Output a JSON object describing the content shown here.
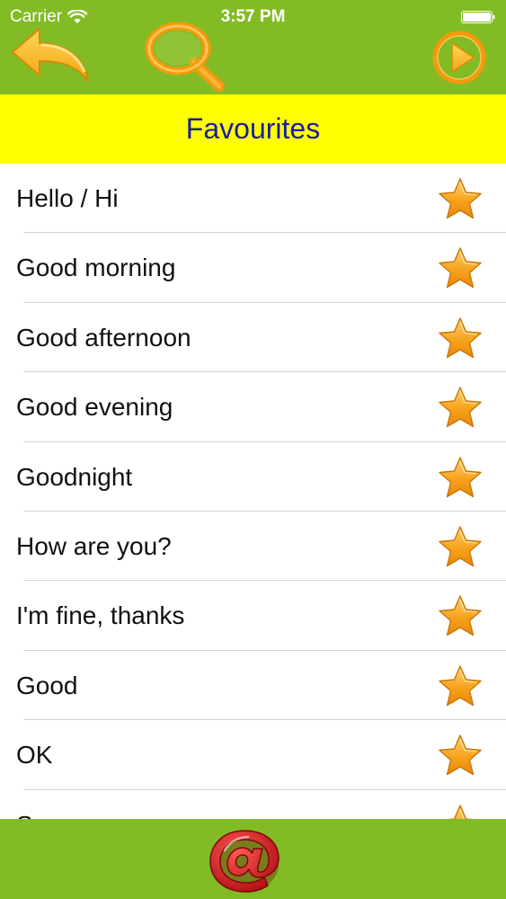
{
  "status_bar": {
    "carrier": "Carrier",
    "time": "3:57 PM"
  },
  "nav": {
    "back_icon": "back-arrow-icon",
    "search_icon": "magnifier-icon",
    "play_icon": "play-icon"
  },
  "header": {
    "title": "Favourites"
  },
  "list": {
    "items": [
      {
        "label": "Hello / Hi"
      },
      {
        "label": "Good morning"
      },
      {
        "label": "Good afternoon"
      },
      {
        "label": "Good evening"
      },
      {
        "label": "Goodnight"
      },
      {
        "label": "How are you?"
      },
      {
        "label": "I'm fine, thanks"
      },
      {
        "label": "Good"
      },
      {
        "label": "OK"
      },
      {
        "label": "So-so"
      }
    ]
  },
  "footer": {
    "email_icon": "at-sign-icon"
  },
  "colors": {
    "bar_green": "#83bb24",
    "title_yellow": "#ffff00",
    "title_text": "#1d1d9c",
    "icon_orange": "#f39a0c",
    "email_red": "#c8141c"
  }
}
